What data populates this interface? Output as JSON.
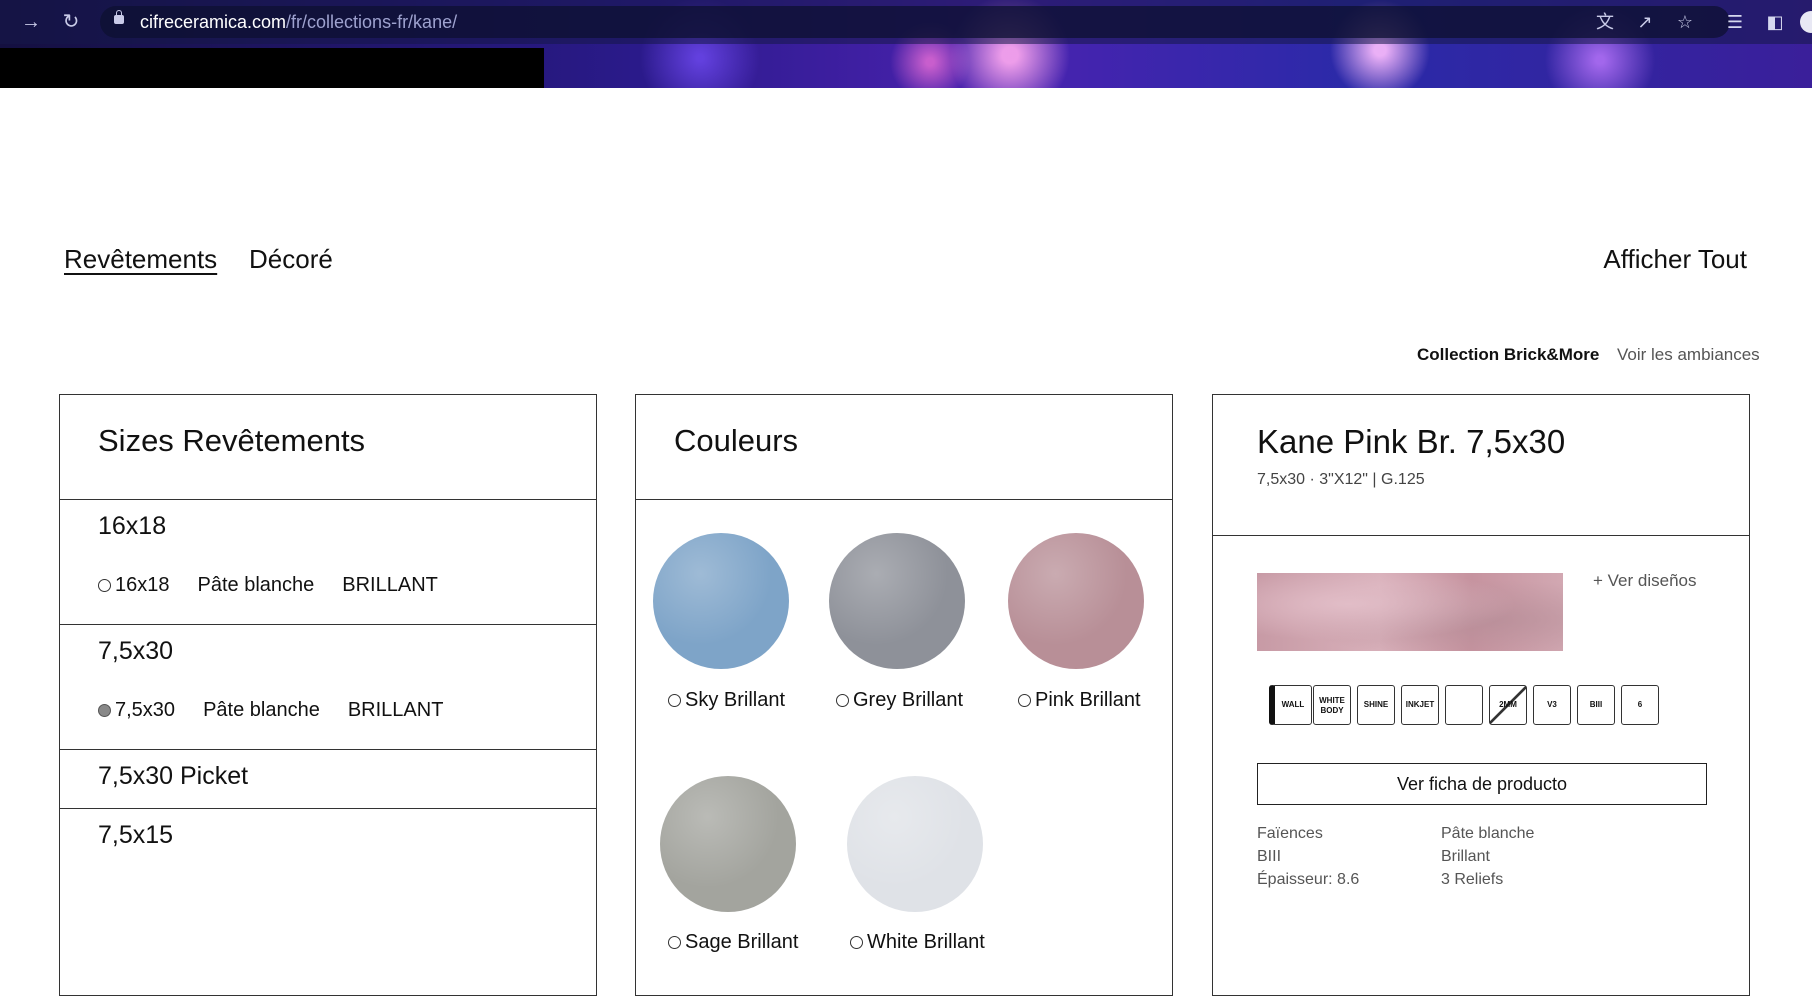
{
  "browser": {
    "url_host": "cifreceramica.com",
    "url_path": "/fr/collections-fr/kane/",
    "icons": [
      "forward-icon",
      "reload-icon",
      "lock-icon",
      "translate-icon",
      "share-icon",
      "star-icon",
      "reading-list-icon",
      "sidebar-icon",
      "profile-avatar"
    ]
  },
  "tabs": {
    "items": [
      "Revêtements",
      "Décoré"
    ],
    "active": "Revêtements",
    "show_all": "Afficher Tout"
  },
  "subnav": {
    "collection": "Collection Brick&More",
    "ambiances": "Voir les ambiances"
  },
  "sizes": {
    "title": "Sizes Revêtements",
    "groups": [
      {
        "name": "16x18",
        "option": {
          "size": "16x18",
          "body": "Pâte blanche",
          "finish": "BRILLANT",
          "selected": false
        }
      },
      {
        "name": "7,5x30",
        "option": {
          "size": "7,5x30",
          "body": "Pâte blanche",
          "finish": "BRILLANT",
          "selected": true
        }
      },
      {
        "name": "7,5x30 Picket"
      },
      {
        "name": "7,5x15"
      }
    ]
  },
  "colors": {
    "title": "Couleurs",
    "items": [
      {
        "label": "Sky Brillant",
        "color": "#7ea4c8"
      },
      {
        "label": "Grey Brillant",
        "color": "#8e9199"
      },
      {
        "label": "Pink Brillant",
        "color": "#b88f97"
      },
      {
        "label": "Sage Brillant",
        "color": "#a3a49e"
      },
      {
        "label": "White Brillant",
        "color": "#dfe2e7"
      }
    ]
  },
  "product": {
    "title": "Kane Pink Br. 7,5x30",
    "subtitle": "7,5x30 · 3\"X12\" | G.125",
    "ver_disenos": "+ Ver diseños",
    "badges": [
      "WALL",
      "WHITE BODY",
      "SHINE",
      "INKJET",
      "",
      "2MM",
      "V3",
      "BIII",
      "6"
    ],
    "ficha_button": "Ver ficha de producto",
    "specs_left": [
      "Faïences",
      "BIII",
      "Épaisseur: 8.6"
    ],
    "specs_right": [
      "Pâte blanche",
      "Brillant",
      "3 Reliefs"
    ]
  }
}
